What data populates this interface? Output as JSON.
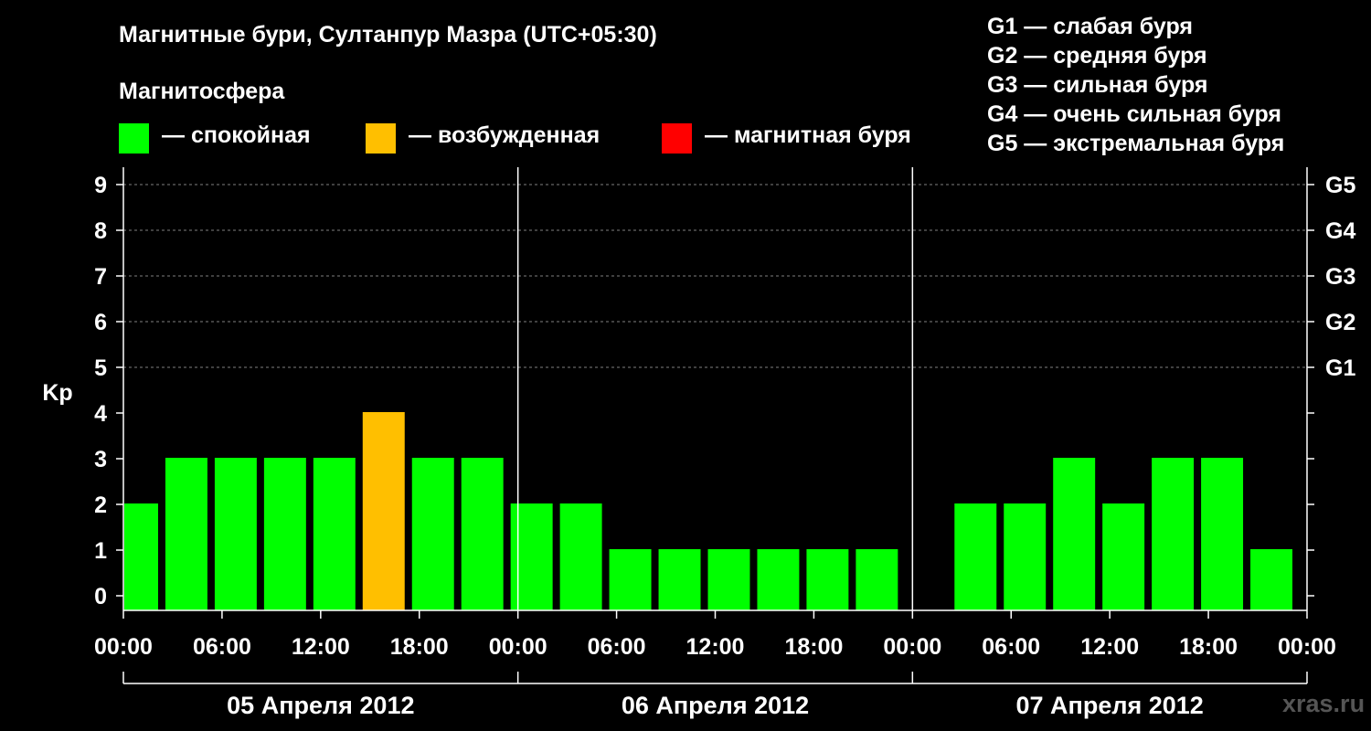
{
  "title": "Магнитные бури, Султанпур Мазра (UTC+05:30)",
  "magnetosphere_label": "Магнитосфера",
  "legend": [
    {
      "color": "#00ff00",
      "label": "— спокойная"
    },
    {
      "color": "#ffbf00",
      "label": "— возбужденная"
    },
    {
      "color": "#ff0000",
      "label": "— магнитная буря"
    }
  ],
  "g_scale": [
    "G1 — слабая буря",
    "G2 — средняя буря",
    "G3 — сильная буря",
    "G4 — очень сильная буря",
    "G5 — экстремальная буря"
  ],
  "watermark": "xras.ru",
  "chart_data": {
    "type": "bar",
    "ylabel": "Kp",
    "ylim": [
      0,
      9
    ],
    "yticks": [
      0,
      1,
      2,
      3,
      4,
      5,
      6,
      7,
      8,
      9
    ],
    "right_axis_labels": [
      {
        "kp": 5,
        "label": "G1"
      },
      {
        "kp": 6,
        "label": "G2"
      },
      {
        "kp": 7,
        "label": "G3"
      },
      {
        "kp": 8,
        "label": "G4"
      },
      {
        "kp": 9,
        "label": "G5"
      }
    ],
    "x_tick_labels": [
      "00:00",
      "06:00",
      "12:00",
      "18:00",
      "00:00",
      "06:00",
      "12:00",
      "18:00",
      "00:00",
      "06:00",
      "12:00",
      "18:00",
      "00:00"
    ],
    "days": [
      "05 Апреля 2012",
      "06 Апреля 2012",
      "07 Апреля 2012"
    ],
    "grid": "dashed at Kp 5–9",
    "bars": [
      {
        "start": "05 Апреля 2012 00:00",
        "kp": 2,
        "level": "calm"
      },
      {
        "start": "05 Апреля 2012 02:30",
        "kp": 3,
        "level": "calm"
      },
      {
        "start": "05 Апреля 2012 05:30",
        "kp": 3,
        "level": "calm"
      },
      {
        "start": "05 Апреля 2012 08:30",
        "kp": 3,
        "level": "calm"
      },
      {
        "start": "05 Апреля 2012 11:30",
        "kp": 3,
        "level": "calm"
      },
      {
        "start": "05 Апреля 2012 14:30",
        "kp": 4,
        "level": "active"
      },
      {
        "start": "05 Апреля 2012 17:30",
        "kp": 3,
        "level": "calm"
      },
      {
        "start": "05 Апреля 2012 20:30",
        "kp": 3,
        "level": "calm"
      },
      {
        "start": "05 Апреля 2012 23:30",
        "kp": 2,
        "level": "calm"
      },
      {
        "start": "06 Апреля 2012 02:30",
        "kp": 2,
        "level": "calm"
      },
      {
        "start": "06 Апреля 2012 05:30",
        "kp": 1,
        "level": "calm"
      },
      {
        "start": "06 Апреля 2012 08:30",
        "kp": 1,
        "level": "calm"
      },
      {
        "start": "06 Апреля 2012 11:30",
        "kp": 1,
        "level": "calm"
      },
      {
        "start": "06 Апреля 2012 14:30",
        "kp": 1,
        "level": "calm"
      },
      {
        "start": "06 Апреля 2012 17:30",
        "kp": 1,
        "level": "calm"
      },
      {
        "start": "06 Апреля 2012 20:30",
        "kp": 1,
        "level": "calm"
      },
      {
        "start": "07 Апреля 2012 02:30",
        "kp": 2,
        "level": "calm"
      },
      {
        "start": "07 Апреля 2012 05:30",
        "kp": 2,
        "level": "calm"
      },
      {
        "start": "07 Апреля 2012 08:30",
        "kp": 3,
        "level": "calm"
      },
      {
        "start": "07 Апреля 2012 11:30",
        "kp": 2,
        "level": "calm"
      },
      {
        "start": "07 Апреля 2012 14:30",
        "kp": 3,
        "level": "calm"
      },
      {
        "start": "07 Апреля 2012 17:30",
        "kp": 3,
        "level": "calm"
      },
      {
        "start": "07 Апреля 2012 20:30",
        "kp": 1,
        "level": "calm"
      }
    ],
    "level_colors": {
      "calm": "#00ff00",
      "active": "#ffbf00",
      "storm": "#ff0000"
    }
  }
}
